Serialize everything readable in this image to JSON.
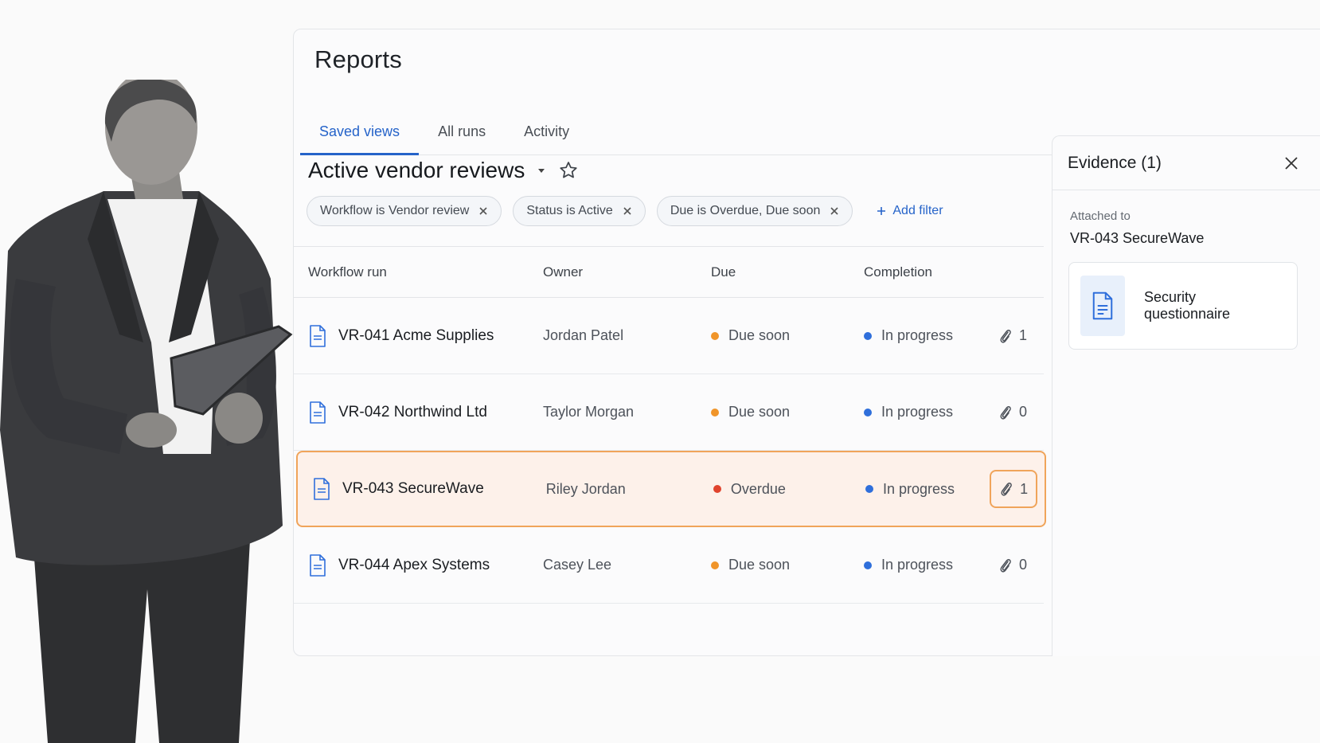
{
  "page": {
    "title": "Reports",
    "tabs": [
      {
        "label": "Saved views",
        "active": true
      },
      {
        "label": "All runs",
        "active": false
      },
      {
        "label": "Activity",
        "active": false
      }
    ]
  },
  "view": {
    "title": "Active vendor reviews",
    "filters": [
      {
        "label": "Workflow is Vendor review"
      },
      {
        "label": "Status is Active"
      },
      {
        "label": "Due is Overdue, Due soon"
      }
    ],
    "add_filter_label": "Add filter"
  },
  "table": {
    "headers": {
      "run": "Workflow run",
      "owner": "Owner",
      "due": "Due",
      "completion": "Completion"
    },
    "rows": [
      {
        "run": "VR-041 Acme Supplies",
        "owner": "Jordan Patel",
        "due": "Due soon",
        "due_color": "#f0952a",
        "completion": "In progress",
        "completion_color": "#2f6fdb",
        "attachments": "1"
      },
      {
        "run": "VR-042 Northwind Ltd",
        "owner": "Taylor Morgan",
        "due": "Due soon",
        "due_color": "#f0952a",
        "completion": "In progress",
        "completion_color": "#2f6fdb",
        "attachments": "0"
      },
      {
        "run": "VR-043 SecureWave",
        "owner": "Riley Jordan",
        "due": "Overdue",
        "due_color": "#e0432d",
        "completion": "In progress",
        "completion_color": "#2f6fdb",
        "attachments": "1",
        "highlighted": true
      },
      {
        "run": "VR-044 Apex Systems",
        "owner": "Casey Lee",
        "due": "Due soon",
        "due_color": "#f0952a",
        "completion": "In progress",
        "completion_color": "#2f6fdb",
        "attachments": "0"
      }
    ]
  },
  "panel": {
    "title": "Evidence (1)",
    "attached_label": "Attached to",
    "attached_value": "VR-043 SecureWave",
    "document_name": "Security questionnaire"
  },
  "colors": {
    "accent": "#2563c9",
    "highlight_border": "#f0a45a",
    "highlight_bg": "#fdf1ea"
  },
  "icons": [
    "chevron-down-icon",
    "star-icon",
    "close-icon",
    "plus-icon",
    "document-icon",
    "paperclip-icon"
  ]
}
